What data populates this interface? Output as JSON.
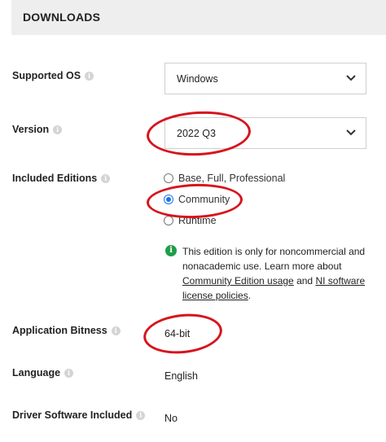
{
  "header": {
    "title": "DOWNLOADS"
  },
  "supported_os": {
    "label": "Supported OS",
    "value": "Windows"
  },
  "version": {
    "label": "Version",
    "value": "2022 Q3"
  },
  "editions": {
    "label": "Included Editions",
    "options": [
      "Base, Full, Professional",
      "Community",
      "Runtime"
    ],
    "selected": "Community"
  },
  "notice": {
    "text_before": "This edition is only for noncommercial and nonacademic use. Learn more about ",
    "link1": "Community Edition usage",
    "text_middle": " and ",
    "link2": "NI software license policies",
    "text_after": "."
  },
  "bitness": {
    "label": "Application Bitness",
    "value": "64-bit"
  },
  "language": {
    "label": "Language",
    "value": "English"
  },
  "driver": {
    "label": "Driver Software Included",
    "value": "No"
  },
  "colors": {
    "annotation": "#d7141c",
    "info_green": "#1e9e4a",
    "radio_blue": "#1a73e8"
  }
}
